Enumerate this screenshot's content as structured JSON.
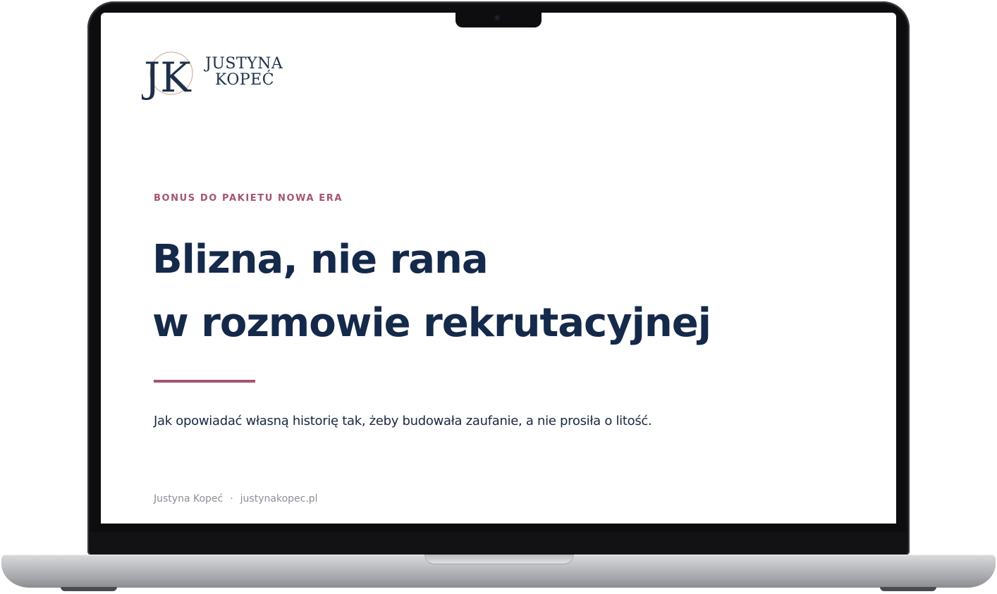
{
  "slide": {
    "logo": {
      "monogram": "JK",
      "name_line1": "JUSTYNA",
      "name_line2": "KOPEĆ"
    },
    "eyebrow": "BONUS DO PAKIETU NOWA ERA",
    "headline": {
      "line1": "Blizna, nie rana",
      "line2": "w rozmowie rekrutacyjnej"
    },
    "subtitle": "Jak opowiadać własną historię tak, żeby budowała zaufanie, a nie prosiła o litość.",
    "footer": {
      "author": "Justyna Kopeć",
      "separator": "·",
      "website": "justynakopec.pl"
    }
  },
  "colors": {
    "navy": "#15294a",
    "rose_accent": "#a45570",
    "muted_gray": "#8b8f96"
  },
  "icons": {
    "logo_mark": "jk-monogram-logo",
    "device": "laptop-frame"
  }
}
